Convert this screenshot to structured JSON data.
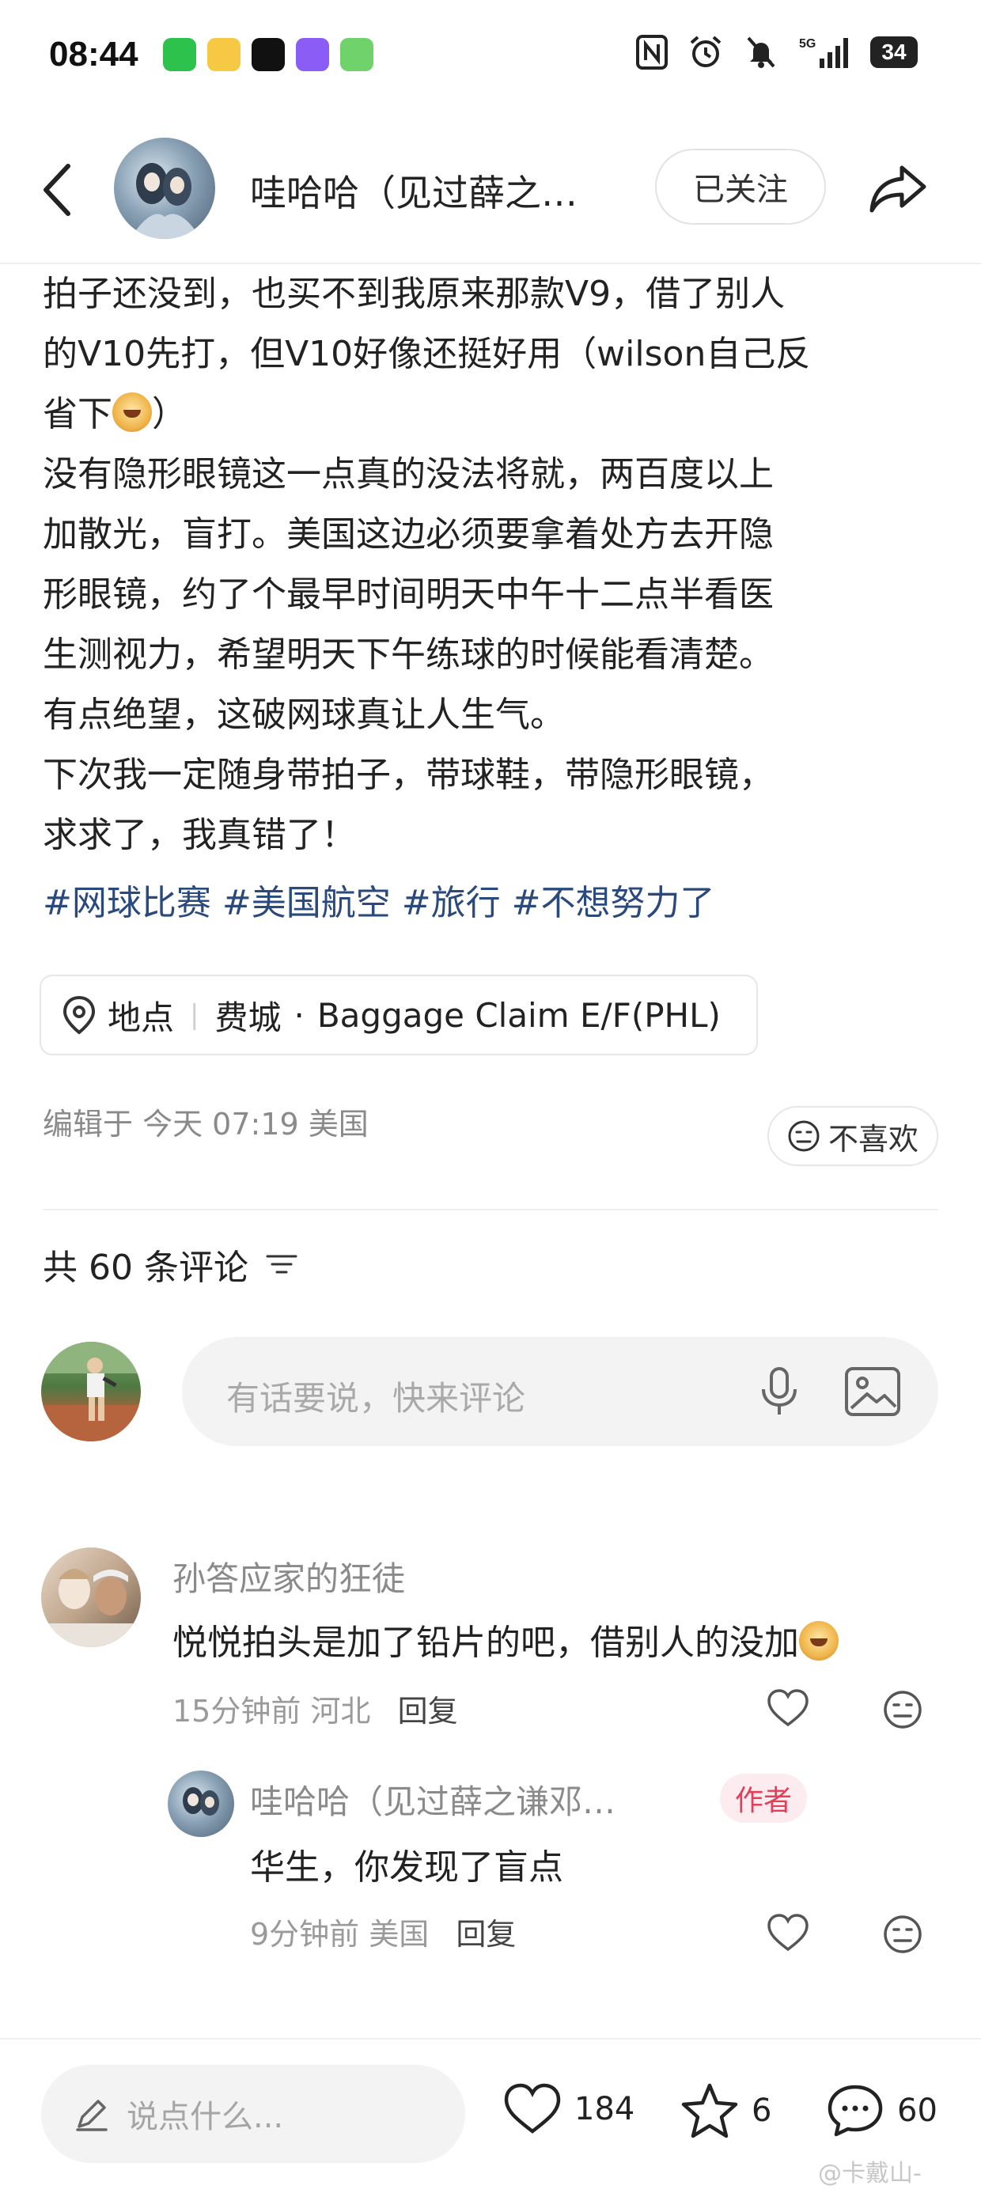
{
  "status_bar": {
    "time": "08:44",
    "battery": "34",
    "network": "5G"
  },
  "header": {
    "author_name": "哇哈哈（见过薛之…",
    "follow_label": "已关注"
  },
  "post": {
    "lines": [
      "拍子还没到，也买不到我原来那款V9，借了别人",
      "的V10先打，但V10好像还挺好用（wilson自己反",
      "省下",
      "）",
      "没有隐形眼镜这一点真的没法将就，两百度以上",
      "加散光，盲打。美国这边必须要拿着处方去开隐",
      "形眼镜，约了个最早时间明天中午十二点半看医",
      "生测视力，希望明天下午练球的时候能看清楚。",
      "有点绝望，这破网球真让人生气。",
      "下次我一定随身带拍子，带球鞋，带隐形眼镜，",
      "求求了，我真错了！"
    ],
    "tags": [
      "#网球比赛",
      "#美国航空",
      "#旅行",
      "#不想努力了"
    ],
    "location_label": "地点",
    "location_city": "费城",
    "location_place": "Baggage Claim E/F(PHL)",
    "edited": "编辑于 今天 07:19 美国",
    "dislike_label": "不喜欢"
  },
  "comments_section": {
    "count_label": "共 60 条评论",
    "input_placeholder": "有话要说，快来评论"
  },
  "comments": [
    {
      "user": "孙答应家的狂徒",
      "text": "悦悦拍头是加了铅片的吧，借别人的没加",
      "time": "15分钟前",
      "region": "河北",
      "reply_label": "回复"
    },
    {
      "user": "哇哈哈（见过薛之谦邓…",
      "badge": "作者",
      "text": "华生，你发现了盲点",
      "time": "9分钟前",
      "region": "美国",
      "reply_label": "回复"
    }
  ],
  "bottom_bar": {
    "say_placeholder": "说点什么...",
    "likes": "184",
    "stars": "6",
    "comments": "60"
  },
  "watermark": "@卡戴山-",
  "colors": {
    "tag_blue": "#2a4a7d",
    "author_badge": "#e0405a",
    "wechat_green": "#2dc24b"
  }
}
